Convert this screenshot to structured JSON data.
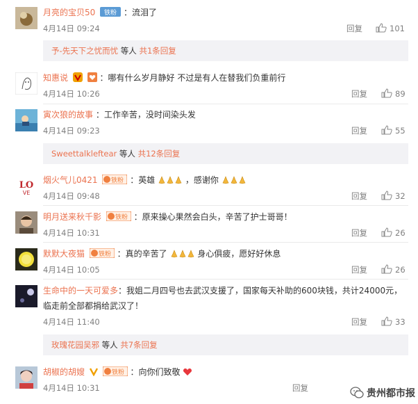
{
  "comments": [
    {
      "user": "月亮的宝贝50",
      "badge": "铁粉",
      "text": "：流泪了",
      "time": "4月14日 09:24",
      "reply": "回复",
      "likes": "101"
    },
    {
      "user": "知惠说",
      "badge": "",
      "text": "：哪有什么岁月静好 不过是有人在替我们负重前行",
      "time": "4月14日 10:26",
      "reply": "回复",
      "likes": "89"
    },
    {
      "user": "寅次狼的故事",
      "badge": "",
      "text": "：工作辛苦，没时间染头发",
      "time": "4月14日 09:23",
      "reply": "回复",
      "likes": "55"
    },
    {
      "user": "烟火气儿0421",
      "badge": "铁粉",
      "text_a": "：英雄",
      "text_b": "，感谢你",
      "time": "4月14日 09:48",
      "reply": "回复",
      "likes": "32"
    },
    {
      "user": "明月送来秋千影",
      "badge": "铁粉",
      "text": "：原来操心果然会白头，辛苦了护士哥哥！",
      "time": "4月14日 10:31",
      "reply": "回复",
      "likes": "26"
    },
    {
      "user": "默默大夜猫",
      "badge": "铁粉",
      "text_a": "：真的辛苦了",
      "text_b": "身心俱疲，愿好好休息",
      "time": "4月14日 10:05",
      "reply": "回复",
      "likes": "26"
    },
    {
      "user": "生命中的一天可爱多",
      "badge": "",
      "text": "：我姐二月四号也去武汉支援了，国家每天补助的600块钱，共计24000元，",
      "text2": "临走前全部都捐给武汉了！",
      "time": "4月14日 11:40",
      "reply": "回复",
      "likes": "33"
    },
    {
      "user": "胡椒的胡嫂",
      "badge": "铁粉",
      "text": "：向你们致敬",
      "time": "4月14日 10:31",
      "reply": "回复"
    }
  ],
  "subreplies": [
    {
      "name": "予-先天下之忧而忧",
      "mid": " 等人 ",
      "count": "共1条回复"
    },
    {
      "name": "Sweettalkleftear",
      "mid": " 等人 ",
      "count": "共12条回复"
    },
    {
      "name": "玫瑰花园吴邪",
      "mid": " 等人 ",
      "count": "共7条回复"
    }
  ],
  "watermark": "贵州都市报",
  "colors": {
    "username": "#eb7350",
    "meta": "#808080",
    "subbar_bg": "#f2f2f5"
  }
}
